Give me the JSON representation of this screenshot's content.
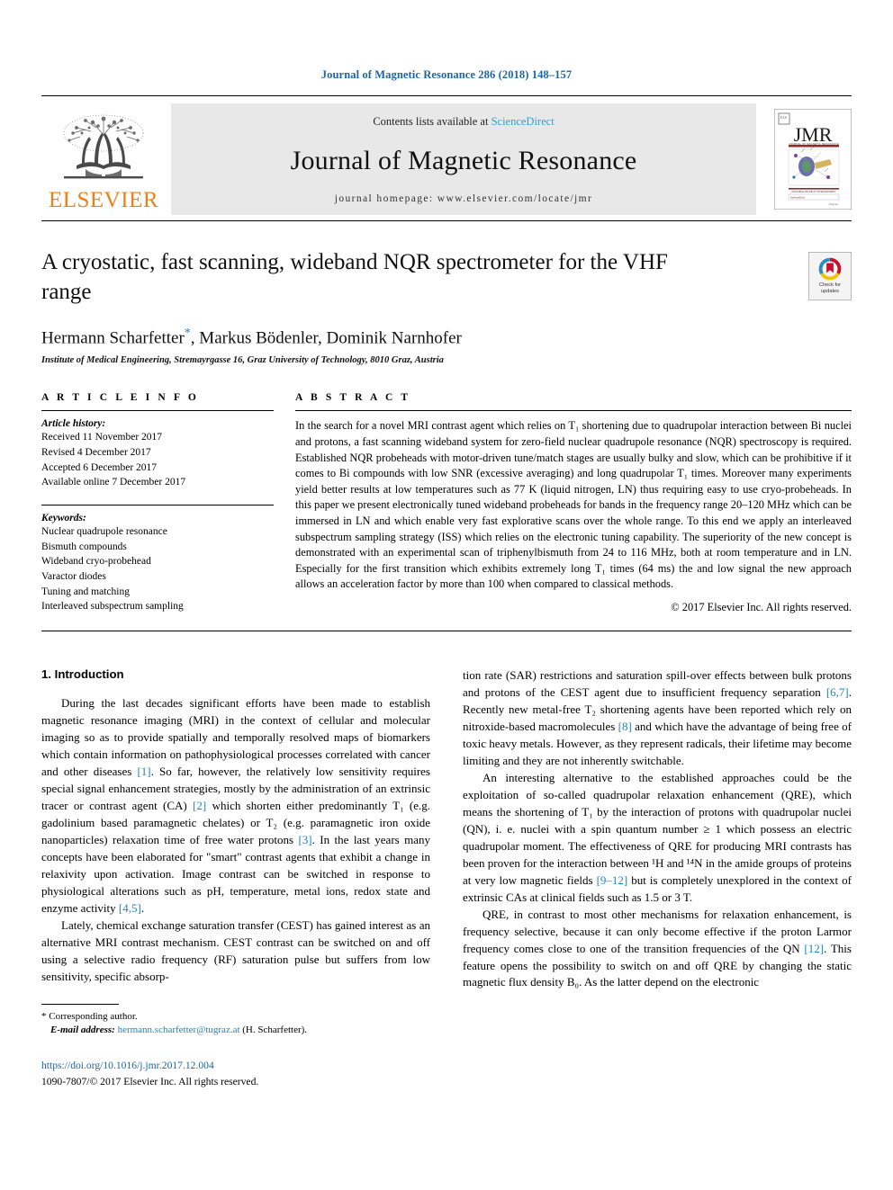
{
  "running_head": "Journal of Magnetic Resonance 286 (2018) 148–157",
  "masthead": {
    "publisher_name": "ELSEVIER",
    "contents_prefix": "Contents lists available at ",
    "contents_link": "ScienceDirect",
    "journal_title": "Journal of Magnetic Resonance",
    "homepage": "journal homepage: www.elsevier.com/locate/jmr",
    "cover_title": "JMR",
    "cover_subtitle": "JOURNAL OF MAGNETIC RESONANCE"
  },
  "article": {
    "title": "A cryostatic, fast scanning, wideband NQR spectrometer for the VHF range",
    "authors": "Hermann Scharfetter*, Markus Bödenler, Dominik Narnhofer",
    "authors_pre_star": "Hermann Scharfetter",
    "authors_post_star": ", Markus Bödenler, Dominik Narnhofer",
    "corresponding_marker": "*",
    "affiliation": "Institute of Medical Engineering, Stremayrgasse 16, Graz University of Technology, 8010 Graz, Austria"
  },
  "crossmark": {
    "label_line1": "Check for",
    "label_line2": "updates",
    "colors": {
      "red": "#c8102e",
      "yellow": "#f2c300",
      "blue": "#2b8cbe"
    }
  },
  "article_info": {
    "heading": "A R T I C L E    I N F O",
    "history_label": "Article history:",
    "history": [
      "Received 11 November 2017",
      "Revised 4 December 2017",
      "Accepted 6 December 2017",
      "Available online 7 December 2017"
    ],
    "keywords_label": "Keywords:",
    "keywords": [
      "Nuclear quadrupole resonance",
      "Bismuth compounds",
      "Wideband cryo-probehead",
      "Varactor diodes",
      "Tuning and matching",
      "Interleaved subspectrum sampling"
    ]
  },
  "abstract": {
    "heading": "A B S T R A C T",
    "text": "In the search for a novel MRI contrast agent which relies on T₁ shortening due to quadrupolar interaction between Bi nuclei and protons, a fast scanning wideband system for zero-field nuclear quadrupole resonance (NQR) spectroscopy is required. Established NQR probeheads with motor-driven tune/match stages are usually bulky and slow, which can be prohibitive if it comes to Bi compounds with low SNR (excessive averaging) and long quadrupolar T₁ times. Moreover many experiments yield better results at low temperatures such as 77 K (liquid nitrogen, LN) thus requiring easy to use cryo-probeheads. In this paper we present electronically tuned wideband probeheads for bands in the frequency range 20–120 MHz which can be immersed in LN and which enable very fast explorative scans over the whole range. To this end we apply an interleaved subspectrum sampling strategy (ISS) which relies on the electronic tuning capability. The superiority of the new concept is demonstrated with an experimental scan of triphenylbismuth from 24 to 116 MHz, both at room temperature and in LN. Especially for the first transition which exhibits extremely long T₁ times (64 ms) the and low signal the new approach allows an acceleration factor by more than 100 when compared to classical methods.",
    "copyright": "© 2017 Elsevier Inc. All rights reserved."
  },
  "body": {
    "section_number_title": "1. Introduction",
    "left_paragraphs": [
      "During the last decades significant efforts have been made to establish magnetic resonance imaging (MRI) in the context of cellular and molecular imaging so as to provide spatially and temporally resolved maps of biomarkers which contain information on pathophysiological processes correlated with cancer and other diseases [1]. So far, however, the relatively low sensitivity requires special signal enhancement strategies, mostly by the administration of an extrinsic tracer or contrast agent (CA) [2] which shorten either predominantly T₁ (e.g. gadolinium based paramagnetic chelates) or T₂ (e.g. paramagnetic iron oxide nanoparticles) relaxation time of free water protons [3]. In the last years many concepts have been elaborated for \"smart\" contrast agents that exhibit a change in relaxivity upon activation. Image contrast can be switched in response to physiological alterations such as pH, temperature, metal ions, redox state and enzyme activity [4,5].",
      "Lately, chemical exchange saturation transfer (CEST) has gained interest as an alternative MRI contrast mechanism. CEST contrast can be switched on and off using a selective radio frequency (RF) saturation pulse but suffers from low sensitivity, specific absorp-"
    ],
    "right_paragraphs": [
      "tion rate (SAR) restrictions and saturation spill-over effects between bulk protons and protons of the CEST agent due to insufficient frequency separation [6,7]. Recently new metal-free T₂ shortening agents have been reported which rely on nitroxide-based macromolecules [8] and which have the advantage of being free of toxic heavy metals. However, as they represent radicals, their lifetime may become limiting and they are not inherently switchable.",
      "An interesting alternative to the established approaches could be the exploitation of so-called quadrupolar relaxation enhancement (QRE), which means the shortening of T₁ by the interaction of protons with quadrupolar nuclei (QN), i. e. nuclei with a spin quantum number ≥ 1 which possess an electric quadrupolar moment. The effectiveness of QRE for producing MRI contrasts has been proven for the interaction between ¹H and ¹⁴N in the amide groups of proteins at very low magnetic fields [9–12] but is completely unexplored in the context of extrinsic CAs at clinical fields such as 1.5 or 3 T.",
      "QRE, in contrast to most other mechanisms for relaxation enhancement, is frequency selective, because it can only become effective if the proton Larmor frequency comes close to one of the transition frequencies of the QN [12]. This feature opens the possibility to switch on and off QRE by changing the static magnetic flux density B₀. As the latter depend on the electronic"
    ]
  },
  "footnote": {
    "star": "*",
    "corresponding": "Corresponding author.",
    "email_label": "E-mail address:",
    "email": "hermann.scharfetter@tugraz.at",
    "email_suffix": "(H. Scharfetter)."
  },
  "doi": {
    "url": "https://doi.org/10.1016/j.jmr.2017.12.004",
    "issn_line": "1090-7807/© 2017 Elsevier Inc. All rights reserved."
  }
}
